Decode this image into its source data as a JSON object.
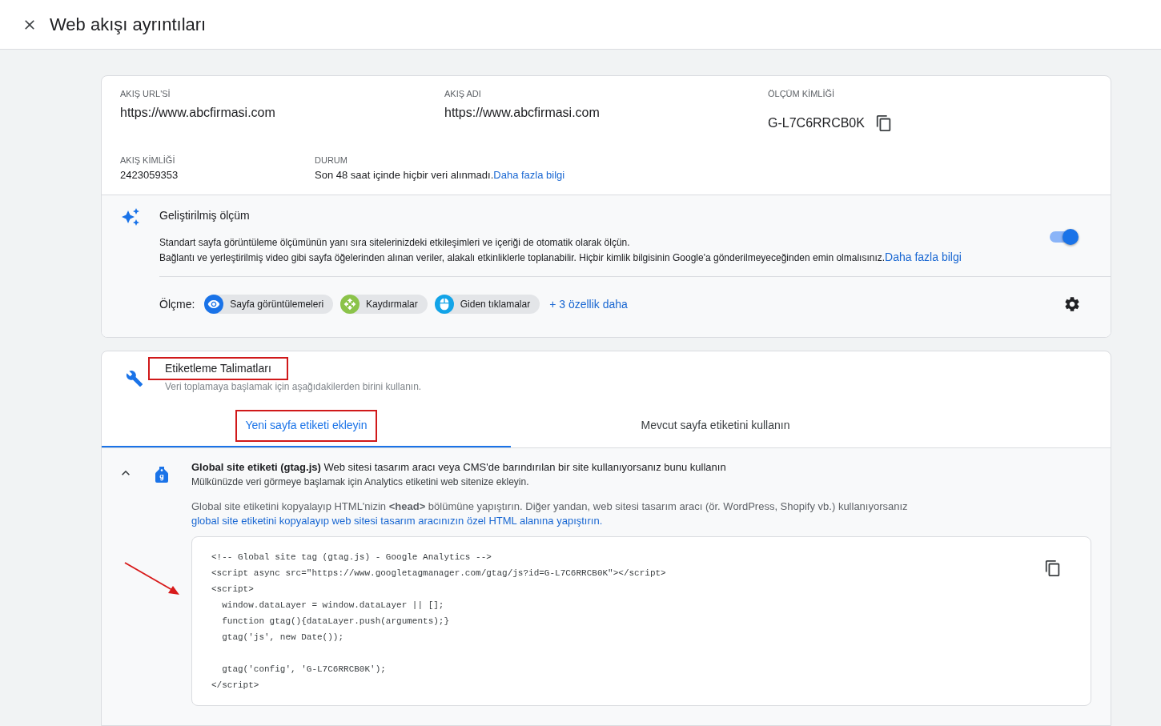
{
  "header": {
    "title": "Web akışı ayrıntıları"
  },
  "stream_details": {
    "fields": [
      {
        "label": "AKIŞ URL'Sİ",
        "value": "https://www.abcfirmasi.com",
        "kind": "plain"
      },
      {
        "label": "AKIŞ ADI",
        "value": "https://www.abcfirmasi.com",
        "kind": "plain"
      },
      {
        "label": "ÖLÇÜM KİMLİĞİ",
        "value": "G-L7C6RRCB0K",
        "kind": "copyable"
      }
    ],
    "stream_id": {
      "label": "AKIŞ KİMLİĞİ",
      "value": "2423059353"
    },
    "status": {
      "label": "DURUM",
      "text": "Son 48 saat içinde hiçbir veri alınmadı.",
      "link": "Daha fazla bilgi"
    }
  },
  "enhanced_measurement": {
    "title": "Geliştirilmiş ölçüm",
    "description": "Standart sayfa görüntüleme ölçümünün yanı sıra sitelerinizdeki etkileşimleri ve içeriği de otomatik olarak ölçün.",
    "note": "Bağlantı ve yerleştirilmiş video gibi sayfa öğelerinden alınan veriler, alakalı etkinliklerle toplanabilir. Hiçbir kimlik bilgisinin Google'a gönderilmeyeceğinden emin olmalısınız.",
    "link": "Daha fazla bilgi",
    "on": true,
    "measuring_label": "Ölçme:",
    "features": [
      {
        "kind": "pageviews",
        "label": "Sayfa görüntülemeleri",
        "color": "#1a73e8"
      },
      {
        "kind": "scrolls",
        "label": "Kaydırmalar",
        "color": "#8bc34a"
      },
      {
        "kind": "clicks",
        "label": "Giden tıklamalar",
        "color": "#12a4e8"
      }
    ],
    "more_link": "+ 3 özellik daha"
  },
  "tagging_instructions": {
    "title": "Etiketleme Talimatları",
    "title_highlighted": true,
    "subtitle": "Veri toplamaya başlamak için aşağıdakilerden birini kullanın.",
    "tabs": [
      {
        "label": "Yeni sayfa etiketi ekleyin",
        "selected": true,
        "highlighted": true
      },
      {
        "label": "Mevcut sayfa etiketini kullanın",
        "selected": false,
        "highlighted": false
      }
    ],
    "global_tag": {
      "expanded": true,
      "title": "**Global site etiketi (gtag.js)** Web sitesi tasarım aracı veya CMS'de barındırılan bir site kullanıyorsanız bunu kullanın",
      "subtitle": "Mülkünüzde veri görmeye başlamak için Analytics etiketini web sitenize ekleyin.",
      "instructions": "Global site etiketini kopyalayıp HTML'nizin **<head>** bölümüne yapıştırın. Diğer yandan, web sitesi tasarım aracı (ör. WordPress, Shopify vb.) kullanıyorsanız",
      "instructions_link": "global site etiketini kopyalayıp web sitesi tasarım aracınızın özel HTML alanına yapıştırın.",
      "code": "<!-- Global site tag (gtag.js) - Google Analytics -->\n<script async src=\"https://www.googletagmanager.com/gtag/js?id=G-L7C6RRCB0K\"></script>\n<script>\n  window.dataLayer = window.dataLayer || [];\n  function gtag(){dataLayer.push(arguments);}\n  gtag('js', new Date());\n\n  gtag('config', 'G-L7C6RRCB0K');\n</script>"
    }
  }
}
